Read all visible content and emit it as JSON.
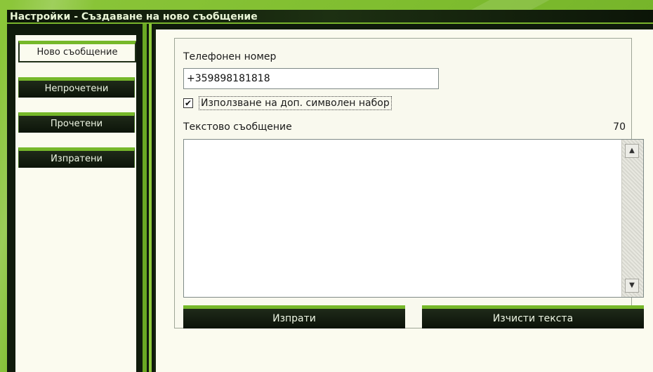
{
  "window": {
    "title": "Настройки - Създаване на ново съобщение"
  },
  "sidebar": {
    "items": [
      {
        "label": "Ново съобщение",
        "active": true
      },
      {
        "label": "Непрочетени",
        "active": false
      },
      {
        "label": "Прочетени",
        "active": false
      },
      {
        "label": "Изпратени",
        "active": false
      }
    ]
  },
  "form": {
    "phone_label": "Телефонен номер",
    "phone_value": "+359898181818",
    "charset_checkbox_label": "Използване на доп. символен набор",
    "charset_checked": true,
    "message_label": "Текстово съобщение",
    "char_counter": "70",
    "message_value": "",
    "send_label": "Изпрати",
    "clear_label": "Изчисти текста"
  },
  "colors": {
    "background_green": "#7fbd2f",
    "frame_dark": "#101b0c",
    "button_accent": "#76b82a",
    "panel_bg": "#fbfbef"
  }
}
